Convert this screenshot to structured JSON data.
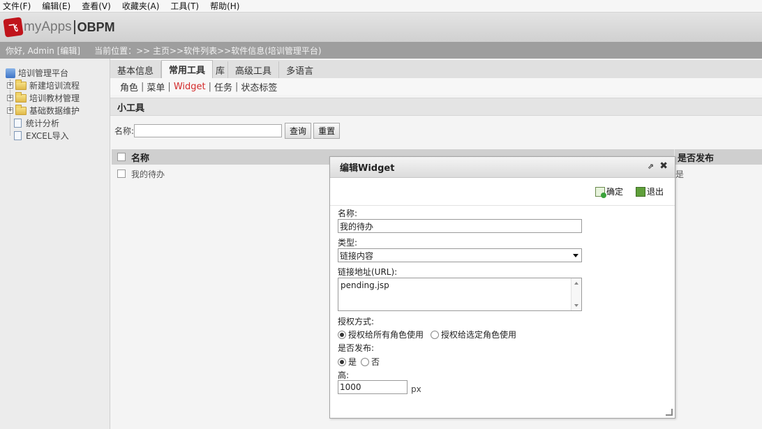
{
  "menubar": [
    "文件(F)",
    "编辑(E)",
    "查看(V)",
    "收藏夹(A)",
    "工具(T)",
    "帮助(H)"
  ],
  "header": {
    "logo_mark": "飞",
    "app_name": "myApps",
    "app_suffix": "OBPM"
  },
  "status": {
    "greeting": "你好, Admin [编辑]",
    "location": "当前位置：>> 主页>>软件列表>>软件信息(培训管理平台)"
  },
  "sidebar": {
    "root": "培训管理平台",
    "items": [
      {
        "label": "新建培训流程",
        "type": "folder"
      },
      {
        "label": "培训教材管理",
        "type": "folder"
      },
      {
        "label": "基础数据维护",
        "type": "folder"
      },
      {
        "label": "统计分析",
        "type": "doc"
      },
      {
        "label": "EXCEL导入",
        "type": "doc"
      }
    ]
  },
  "tabs": [
    "基本信息",
    "常用工具",
    "库",
    "高级工具",
    "多语言"
  ],
  "active_tab": "常用工具",
  "subnav": [
    "角色",
    "菜单",
    "Widget",
    "任务",
    "状态标签"
  ],
  "active_subnav": "Widget",
  "section_title": "小工具",
  "search": {
    "label": "名称:",
    "value": "",
    "query_button": "查询",
    "reset_button": "重置"
  },
  "table": {
    "columns": [
      "名称",
      "是否发布"
    ],
    "rows": [
      {
        "name": "我的待办",
        "published": "是"
      }
    ]
  },
  "dialog": {
    "title": "编辑Widget",
    "ok_label": "确定",
    "exit_label": "退出",
    "name_label": "名称:",
    "name_value": "我的待办",
    "type_label": "类型:",
    "type_value": "链接内容",
    "url_label": "链接地址(URL):",
    "url_value": "pending.jsp",
    "auth_label": "授权方式:",
    "auth_options": [
      "授权给所有角色使用",
      "授权给选定角色使用"
    ],
    "auth_selected": 0,
    "publish_label": "是否发布:",
    "publish_options": [
      "是",
      "否"
    ],
    "publish_selected": 0,
    "height_label": "高:",
    "height_value": "1000",
    "height_unit": "px"
  }
}
